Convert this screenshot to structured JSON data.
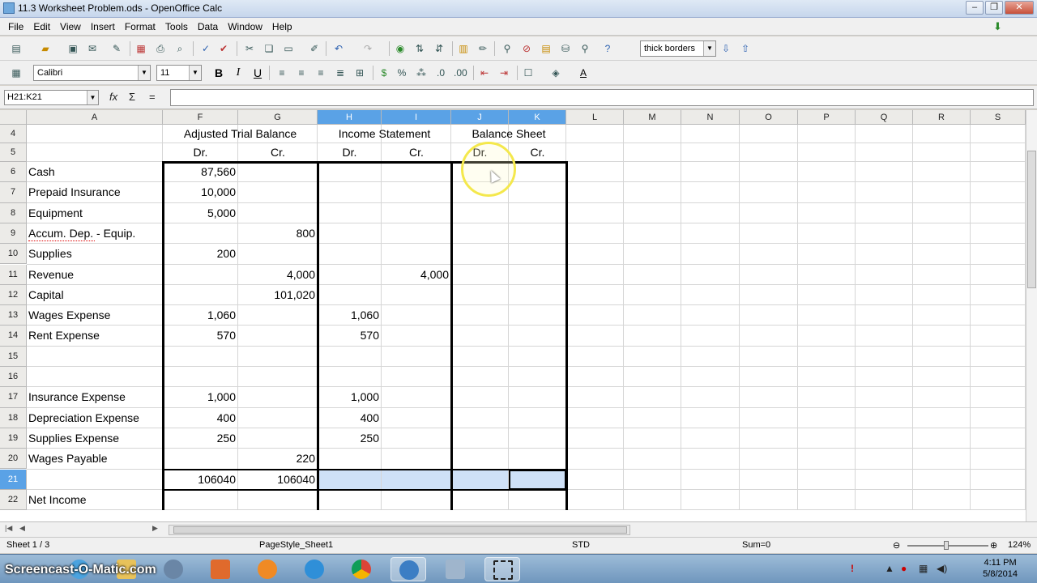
{
  "window": {
    "title": "11.3 Worksheet Problem.ods - OpenOffice Calc"
  },
  "menu": [
    "File",
    "Edit",
    "View",
    "Insert",
    "Format",
    "Tools",
    "Data",
    "Window",
    "Help"
  ],
  "toolbar": {
    "border_style": "thick borders",
    "font_name": "Calibri",
    "font_size": "11"
  },
  "formula_bar": {
    "name_box": "H21:K21",
    "formula": ""
  },
  "columns": [
    "A",
    "F",
    "G",
    "H",
    "I",
    "J",
    "K",
    "L",
    "M",
    "N",
    "O",
    "P",
    "Q",
    "R",
    "S"
  ],
  "selected_columns": [
    "H",
    "I",
    "J",
    "K"
  ],
  "selected_row": "21",
  "header_rows": {
    "row4": {
      "num": "4",
      "F": "Adjusted Trial Balance",
      "H": "Income Statement",
      "J": "Balance Sheet"
    },
    "row5": {
      "num": "5",
      "F": "Dr.",
      "G": "Cr.",
      "H": "Dr.",
      "I": "Cr.",
      "J": "Dr.",
      "K": "Cr."
    }
  },
  "rows": [
    {
      "num": "6",
      "A": "Cash",
      "F": "87,560",
      "G": "",
      "H": "",
      "I": ""
    },
    {
      "num": "7",
      "A": "Prepaid Insurance",
      "F": "10,000",
      "G": "",
      "H": "",
      "I": ""
    },
    {
      "num": "8",
      "A": "Equipment",
      "F": "5,000",
      "G": "",
      "H": "",
      "I": ""
    },
    {
      "num": "9",
      "A": "Accum. Dep. - Equip.",
      "F": "",
      "G": "800",
      "H": "",
      "I": ""
    },
    {
      "num": "10",
      "A": "Supplies",
      "F": "200",
      "G": "",
      "H": "",
      "I": ""
    },
    {
      "num": "11",
      "A": "Revenue",
      "F": "",
      "G": "4,000",
      "H": "",
      "I": "4,000"
    },
    {
      "num": "12",
      "A": "Capital",
      "F": "",
      "G": "101,020",
      "H": "",
      "I": ""
    },
    {
      "num": "13",
      "A": "Wages Expense",
      "F": "1,060",
      "G": "",
      "H": "1,060",
      "I": ""
    },
    {
      "num": "14",
      "A": "Rent Expense",
      "F": "570",
      "G": "",
      "H": "570",
      "I": ""
    },
    {
      "num": "15",
      "A": "",
      "F": "",
      "G": "",
      "H": "",
      "I": ""
    },
    {
      "num": "16",
      "A": "",
      "F": "",
      "G": "",
      "H": "",
      "I": ""
    },
    {
      "num": "17",
      "A": "Insurance Expense",
      "F": "1,000",
      "G": "",
      "H": "1,000",
      "I": ""
    },
    {
      "num": "18",
      "A": "Depreciation Expense",
      "F": "400",
      "G": "",
      "H": "400",
      "I": ""
    },
    {
      "num": "19",
      "A": "Supplies Expense",
      "F": "250",
      "G": "",
      "H": "250",
      "I": ""
    },
    {
      "num": "20",
      "A": "Wages Payable",
      "F": "",
      "G": "220",
      "H": "",
      "I": ""
    },
    {
      "num": "21",
      "A": "",
      "F": "106040",
      "G": "106040",
      "H": "",
      "I": ""
    },
    {
      "num": "22",
      "A": "Net Income",
      "F": "",
      "G": "",
      "H": "",
      "I": ""
    }
  ],
  "sheet_tabs": {
    "position": "Sheet 1 / 3",
    "page_style": "PageStyle_Sheet1",
    "mode": "STD",
    "sum": "Sum=0",
    "zoom": "124%"
  },
  "taskbar": {
    "watermark": "Screencast-O-Matic.com",
    "time": "4:11 PM",
    "date": "5/8/2014"
  }
}
